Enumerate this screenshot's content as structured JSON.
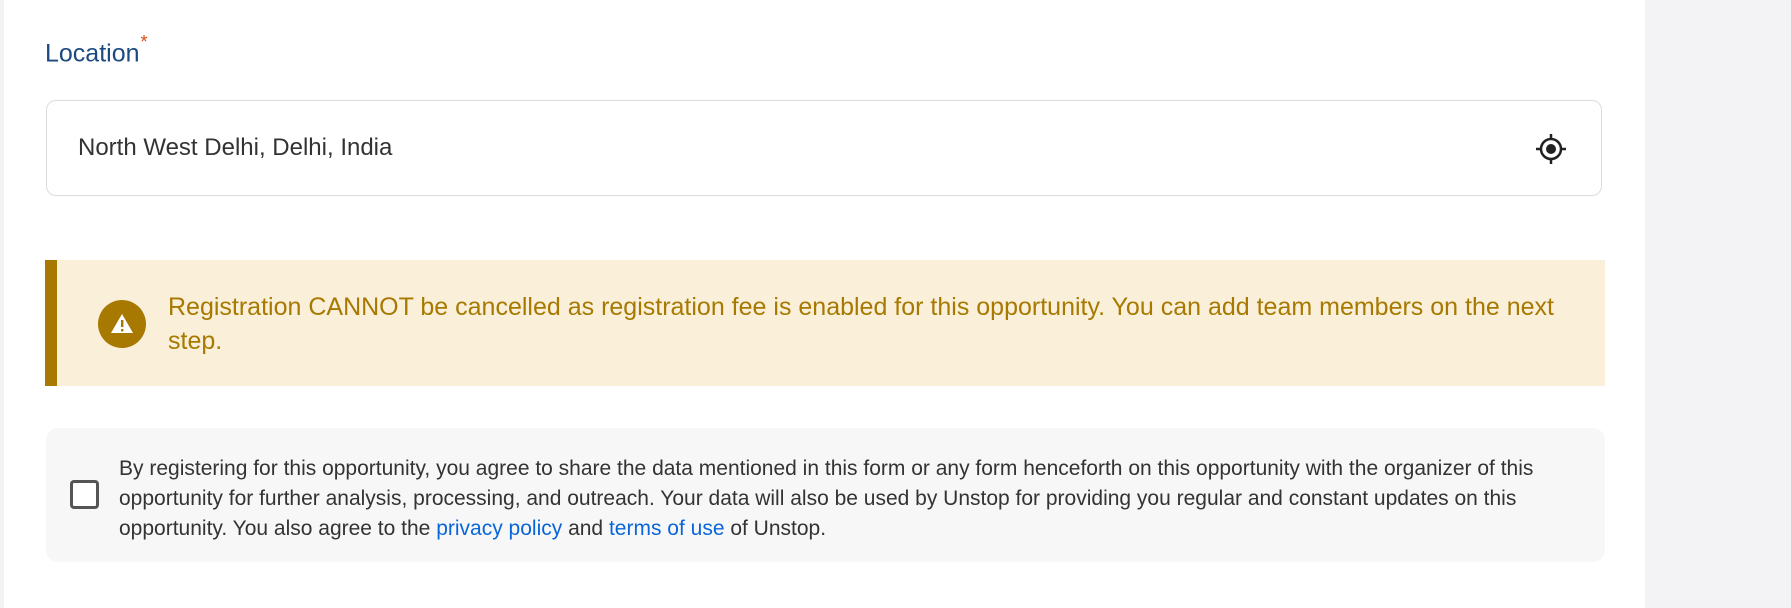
{
  "location_field": {
    "label": "Location",
    "required_marker": "*",
    "value": "North West Delhi, Delhi, India",
    "icon": "locate-crosshair-icon"
  },
  "alert": {
    "icon": "warning-icon",
    "message": "Registration CANNOT be cancelled as registration fee is enabled for this opportunity. You can add team members on the next step.",
    "color": "#a77900",
    "background": "#faf0da"
  },
  "consent": {
    "checked": false,
    "text_before": "By registering for this opportunity, you agree to share the data mentioned in this form or any form henceforth on this opportunity with the organizer of this opportunity for further analysis, processing, and outreach. Your data will also be used by Unstop for providing you regular and constant updates on this opportunity. You also agree to the ",
    "privacy_link": "privacy policy",
    "text_middle": " and ",
    "terms_link": "terms of use",
    "text_after": " of Unstop."
  }
}
